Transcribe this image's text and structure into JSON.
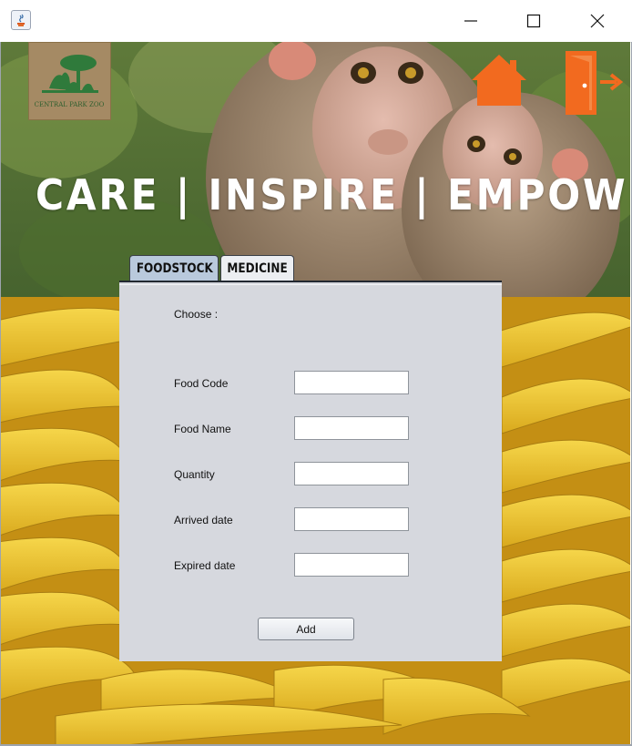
{
  "window": {
    "controls": {
      "minimize_icon": "minimize-icon",
      "maximize_icon": "maximize-icon",
      "close_icon": "close-icon"
    }
  },
  "header": {
    "logo_text": "CENTRAL PARK ZOO",
    "tagline": "CARE | INSPIRE | EMPOWER",
    "home_icon": "home-icon",
    "exit_icon": "exit-door-icon",
    "accent_color": "#f26a1f"
  },
  "tabs": [
    {
      "label": "FOODSTOCK",
      "selected": true
    },
    {
      "label": "MEDICINE",
      "selected": false
    }
  ],
  "form": {
    "choose_label": "Choose :",
    "fields": [
      {
        "label": "Food Code",
        "value": ""
      },
      {
        "label": "Food Name",
        "value": ""
      },
      {
        "label": "Quantity",
        "value": ""
      },
      {
        "label": "Arrived date",
        "value": ""
      },
      {
        "label": "Expired date",
        "value": ""
      }
    ],
    "add_label": "Add"
  }
}
